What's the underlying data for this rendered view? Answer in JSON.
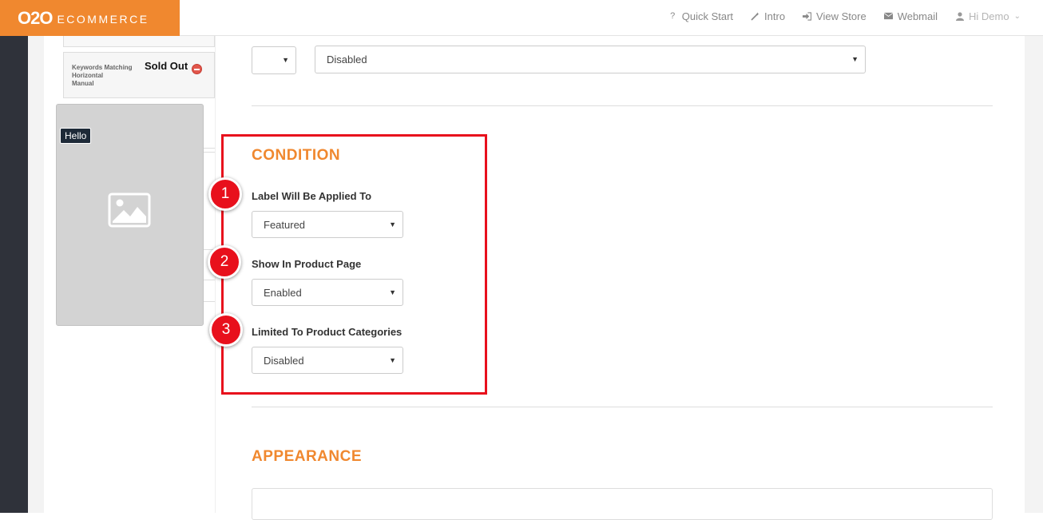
{
  "header": {
    "logo_mark": "O2O",
    "logo_text": "ECOMMERCE",
    "nav": [
      {
        "icon": "question-icon",
        "label": "Quick Start"
      },
      {
        "icon": "wand-icon",
        "label": "Intro"
      },
      {
        "icon": "sign-in-icon",
        "label": "View Store"
      },
      {
        "icon": "envelope-icon",
        "label": "Webmail"
      },
      {
        "icon": "user-icon",
        "label": "Hi Demo"
      }
    ]
  },
  "preview": {
    "keywords_text": [
      "Keywords Matching",
      "Horizontal",
      "Manual"
    ],
    "sold_out": "Sold Out",
    "hello_badge": "Hello",
    "image_icon": "image-placeholder-icon"
  },
  "top_row": {
    "small_select_value": "",
    "wide_select_value": "Disabled"
  },
  "condition": {
    "title": "CONDITION",
    "fields": [
      {
        "number": "1",
        "label": "Label Will Be Applied To",
        "value": "Featured"
      },
      {
        "number": "2",
        "label": "Show In Product Page",
        "value": "Enabled"
      },
      {
        "number": "3",
        "label": "Limited To Product Categories",
        "value": "Disabled"
      }
    ]
  },
  "appearance": {
    "title": "APPEARANCE"
  },
  "colors": {
    "brand_orange": "#f0882f",
    "highlight_red": "#e8101c",
    "sidebar_dark": "#2f323a"
  }
}
